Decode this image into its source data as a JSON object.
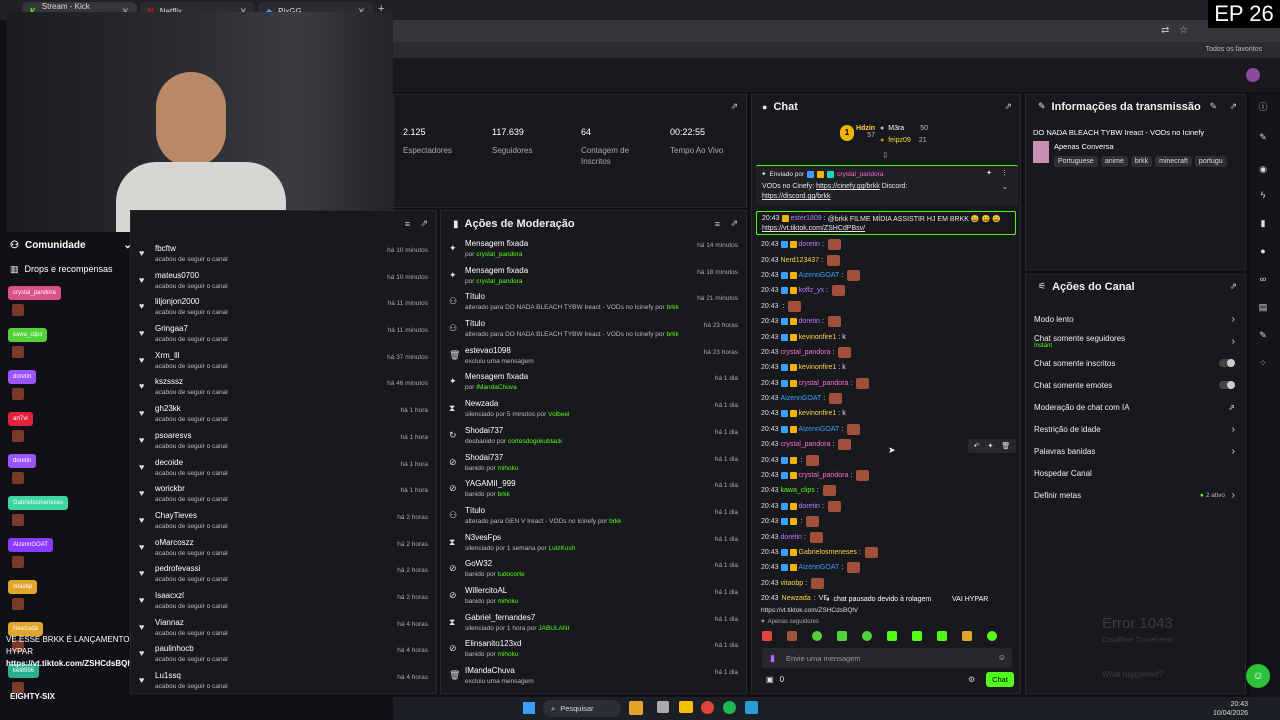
{
  "browser": {
    "tabs": [
      {
        "label": "Stream - Kick Dashboard"
      },
      {
        "label": "Netflix"
      },
      {
        "label": "PixGG"
      }
    ],
    "bookmarks_label": "Todos os favoritos"
  },
  "overlay": {
    "episode": "EP 26"
  },
  "stats": [
    {
      "value": "2.125",
      "label": "Espectadores"
    },
    {
      "value": "117.639",
      "label": "Seguidores"
    },
    {
      "value": "64",
      "label": "Contagem de Inscritos"
    },
    {
      "value": "00:22:55",
      "label": "Tempo Ao Vivo"
    }
  ],
  "followers": {
    "subtitle": "acabou de seguir o canal",
    "items": [
      {
        "name": "fbcftw",
        "time": "há 10 minutos"
      },
      {
        "name": "mateus0700",
        "time": "há 10 minutos"
      },
      {
        "name": "liljonjon2000",
        "time": "há 11 minutos"
      },
      {
        "name": "Gringaa7",
        "time": "há 11 minutos"
      },
      {
        "name": "Xrm_lll",
        "time": "há 37 minutos"
      },
      {
        "name": "kszsssz",
        "time": "há 46 minutos"
      },
      {
        "name": "gh23kk",
        "time": "há 1 hora"
      },
      {
        "name": "psoaresvs",
        "time": "há 1 hora"
      },
      {
        "name": "decoide",
        "time": "há 1 hora"
      },
      {
        "name": "worickbr",
        "time": "há 1 hora"
      },
      {
        "name": "ChayTieves",
        "time": "há 2 horas"
      },
      {
        "name": "oMarcoszz",
        "time": "há 2 horas"
      },
      {
        "name": "pedrofevassi",
        "time": "há 2 horas"
      },
      {
        "name": "Isaacxzl",
        "time": "há 2 horas"
      },
      {
        "name": "Viannaz",
        "time": "há 4 horas"
      },
      {
        "name": "paulinhocb",
        "time": "há 4 horas"
      },
      {
        "name": "Lu1ssq",
        "time": "há 4 horas"
      }
    ]
  },
  "moderation": {
    "title": "Ações de Moderação",
    "items": [
      {
        "icon": "pin",
        "title": "Mensagem fixada",
        "sub": "por ",
        "who": "crystal_pandora",
        "time": "há 14 minutos"
      },
      {
        "icon": "pin",
        "title": "Mensagem fixada",
        "sub": "por ",
        "who": "crystal_pandora",
        "time": "há 18 minutos"
      },
      {
        "icon": "title",
        "title": "Título",
        "sub": "alterado para DO NADA BLEACH TYBW Ireact - VODs no Icinefy por ",
        "who": "brkk",
        "time": "há 21 minutos"
      },
      {
        "icon": "title",
        "title": "Título",
        "sub": "alterado para DO NADA BLEACH TYBW Ireact - VODs no Icinefy por ",
        "who": "brkk",
        "time": "há 23 horas"
      },
      {
        "icon": "trash",
        "title": "estevao1098",
        "sub": "excluiu uma mensagem",
        "who": "",
        "time": "há 23 horas"
      },
      {
        "icon": "pin",
        "title": "Mensagem fixada",
        "sub": "por ",
        "who": "IMandaChuva",
        "time": "há 1 dia"
      },
      {
        "icon": "hourglass",
        "title": "Newzada",
        "sub": "silenciado por 5 minutos por ",
        "who": "Volbeel",
        "time": "há 1 dia"
      },
      {
        "icon": "unban",
        "title": "Shodai737",
        "sub": "desbanido por ",
        "who": "cortesdogokublack",
        "time": "há 1 dia"
      },
      {
        "icon": "ban",
        "title": "Shodai737",
        "sub": "banido por ",
        "who": "mihoku",
        "time": "há 1 dia"
      },
      {
        "icon": "ban",
        "title": "YAGAMII_999",
        "sub": "banido por ",
        "who": "brkk",
        "time": "há 1 dia"
      },
      {
        "icon": "title",
        "title": "Título",
        "sub": "alterado para GEN V Ireact - VODs no Icinefy por ",
        "who": "brkk",
        "time": "há 1 dia"
      },
      {
        "icon": "hourglass",
        "title": "N3vesFps",
        "sub": "silenciado por 1 semana por ",
        "who": "LuizKush",
        "time": "há 1 dia"
      },
      {
        "icon": "ban",
        "title": "GoW32",
        "sub": "banido por ",
        "who": "tudocorte",
        "time": "há 1 dia"
      },
      {
        "icon": "ban",
        "title": "WillercitoAL",
        "sub": "banido por ",
        "who": "mihoku",
        "time": "há 1 dia"
      },
      {
        "icon": "hourglass",
        "title": "Gabriel_fernandes7",
        "sub": "silenciado por 1 hora por ",
        "who": "JABULANI",
        "time": "há 1 dia"
      },
      {
        "icon": "ban",
        "title": "Elinsanito123xd",
        "sub": "banido por ",
        "who": "mihoku",
        "time": "há 1 dia"
      },
      {
        "icon": "trash",
        "title": "IMandaChuva",
        "sub": "excluiu uma mensagem",
        "who": "",
        "time": "há 1 dia"
      }
    ]
  },
  "chat": {
    "title": "Chat",
    "top": [
      {
        "name": "Hdzin",
        "count": "57"
      },
      {
        "name": "M3ra",
        "count": "50"
      },
      {
        "name": "feipz09",
        "count": "21"
      }
    ],
    "pinned": {
      "by_label": "Enviado por",
      "by": "crystal_pandora",
      "text": "VODs no Cinefy: ",
      "link1": "https://cinefy.gg/brkk",
      "mid": " Discord:",
      "link2": "https://discord.gg/brkk"
    },
    "highlight": {
      "time": "20:43",
      "user": "ester1809",
      "text": "@brkk FILME MÍDIA ASSISTIR HJ EM BRKK 😀 😀 😀",
      "link": "https://vt.tiktok.com/ZSHCdPBsv/"
    },
    "messages": [
      {
        "time": "20:43",
        "user": "doretin",
        "color": "#b57bff",
        "text": ""
      },
      {
        "time": "20:43",
        "user": "Nerd123437",
        "color": "#ffd24a",
        "text": ""
      },
      {
        "time": "20:43",
        "user": "AizennGOAT",
        "color": "#3aa0ff",
        "text": ""
      },
      {
        "time": "20:43",
        "user": "koffz_yx",
        "color": "#b57bff",
        "text": ""
      },
      {
        "time": "20:43",
        "user": "",
        "color": "#ff3d6a",
        "text": ""
      },
      {
        "time": "20:43",
        "user": "doretin",
        "color": "#b57bff",
        "text": ""
      },
      {
        "time": "20:43",
        "user": "kevinonfire1",
        "color": "#ffd24a",
        "text": "k"
      },
      {
        "time": "20:43",
        "user": "crystal_pandora",
        "color": "#ff6bd8",
        "text": ""
      },
      {
        "time": "20:43",
        "user": "kevinonfire1",
        "color": "#ffd24a",
        "text": "k"
      },
      {
        "time": "20:43",
        "user": "crystal_pandora",
        "color": "#ff6bd8",
        "text": ""
      },
      {
        "time": "20:43",
        "user": "AizennGOAT",
        "color": "#3aa0ff",
        "text": ""
      },
      {
        "time": "20:43",
        "user": "kevinonfire1",
        "color": "#ffd24a",
        "text": "k"
      },
      {
        "time": "20:43",
        "user": "AizennGOAT",
        "color": "#3aa0ff",
        "text": ""
      },
      {
        "time": "20:43",
        "user": "crystal_pandora",
        "color": "#ff6bd8",
        "text": ""
      },
      {
        "time": "20:43",
        "user": "",
        "color": "#ff3d6a",
        "text": ""
      },
      {
        "time": "20:43",
        "user": "crystal_pandora",
        "color": "#ff6bd8",
        "text": ""
      },
      {
        "time": "20:43",
        "user": "kawa_clips",
        "color": "#53fc18",
        "text": ""
      },
      {
        "time": "20:43",
        "user": "doretin",
        "color": "#b57bff",
        "text": ""
      },
      {
        "time": "20:43",
        "user": "",
        "color": "#ff3d6a",
        "text": ""
      },
      {
        "time": "20:43",
        "user": "doretin",
        "color": "#b57bff",
        "text": ""
      },
      {
        "time": "20:43",
        "user": "Gabrielosmeneses",
        "color": "#ffd24a",
        "text": ""
      },
      {
        "time": "20:43",
        "user": "AizennGOAT",
        "color": "#3aa0ff",
        "text": ""
      },
      {
        "time": "20:43",
        "user": "vitaobp",
        "color": "#ffd24a",
        "text": ""
      }
    ],
    "last": {
      "time": "20:43",
      "user": "Newzada",
      "text": "VE",
      "link": "https://vt.tiktok.com/ZSHCdsBQh/"
    },
    "paused": "chat pausado devido à rolagem",
    "hypar": "VAI HYPAR",
    "followers_only": "Apenas seguidores",
    "placeholder": "Envie uma mensagem",
    "count": "0",
    "send": "Chat"
  },
  "info": {
    "title": "Informações da transmissão",
    "stream_title": "DO NADA BLEACH TYBW Ireact - VODs no Icinefy",
    "category": "Apenas Conversa",
    "tags": [
      "Portuguese",
      "anime",
      "brkk",
      "minecraft",
      "portugu"
    ]
  },
  "channel": {
    "title": "Ações do Canal",
    "rows": [
      {
        "label": "Modo lento",
        "sub": "",
        "ctl": "chev"
      },
      {
        "label": "Chat somente seguidores",
        "sub": "Instant",
        "ctl": "chev"
      },
      {
        "label": "Chat somente inscritos",
        "sub": "",
        "ctl": "toggle"
      },
      {
        "label": "Chat somente emotes",
        "sub": "",
        "ctl": "toggle"
      },
      {
        "label": "Moderação de chat com IA",
        "sub": "",
        "ctl": "ext"
      },
      {
        "label": "Restrição de idade",
        "sub": "",
        "ctl": "chev"
      },
      {
        "label": "Palavras banidas",
        "sub": "",
        "ctl": "chev"
      },
      {
        "label": "Hospedar Canal",
        "sub": "",
        "ctl": ""
      },
      {
        "label": "Definir metas",
        "sub": "",
        "ctl": "chev",
        "meta": "2 ativo"
      }
    ]
  },
  "left": {
    "community": "Comunidade",
    "drops": "Drops e recompensas",
    "pills": [
      {
        "label": "crystal_pandora",
        "color": "#d9508a"
      },
      {
        "label": "kawa_clips",
        "color": "#53d13a"
      },
      {
        "label": "doretin",
        "color": "#9b54ff"
      },
      {
        "label": "art7vl",
        "color": "#e0223b"
      },
      {
        "label": "doretin",
        "color": "#9b54ff"
      },
      {
        "label": "Gabrielosmeneses",
        "color": "#3dd6a0"
      },
      {
        "label": "AizennGOAT",
        "color": "#8a3aff"
      },
      {
        "label": "vitaobp",
        "color": "#e0a52a"
      },
      {
        "label": "Newzada",
        "color": "#e0a52a"
      },
      {
        "label": "kel8996",
        "color": "#28b090"
      }
    ],
    "overlay_msg": "VE ESSE BRKK É LANÇAMENTO E PARECE Q VAI HYPAR",
    "overlay_link": "https://vt.tiktok.com/ZSHCdsBQh/",
    "bottom_name": "EIGHTY-SIX"
  },
  "error": {
    "code": "Error 1043",
    "sub": "Cloudflare Tunnel error",
    "what": "What happened?"
  },
  "taskbar": {
    "search": "Pesquisar",
    "time": "20:43",
    "date": "10/04/2026"
  },
  "colors": {
    "accent": "#53fc18",
    "panel": "#18191c",
    "bg": "#0f1114"
  }
}
